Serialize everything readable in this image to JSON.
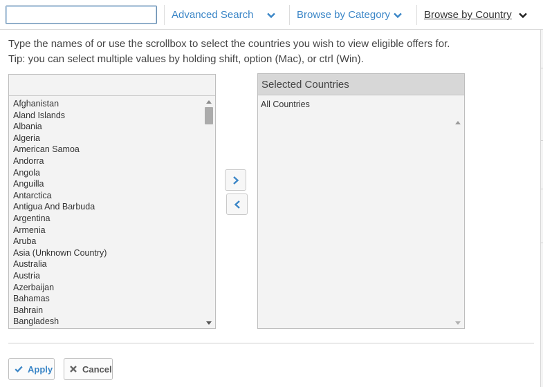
{
  "nav": {
    "search_value": "",
    "advanced_search": "Advanced Search",
    "browse_by_category": "Browse by Category",
    "browse_by_country": "Browse by Country",
    "active_color": "#333333",
    "link_color": "#3b86c7"
  },
  "instructions": {
    "line1": "Type the names of or use the scrollbox to select the countries you wish to view eligible offers for.",
    "line2": "Tip: you can select multiple values by holding shift, option (Mac), or ctrl (Win)."
  },
  "available": {
    "filter_value": "",
    "countries": [
      "Afghanistan",
      "Aland Islands",
      "Albania",
      "Algeria",
      "American Samoa",
      "Andorra",
      "Angola",
      "Anguilla",
      "Antarctica",
      "Antigua And Barbuda",
      "Argentina",
      "Armenia",
      "Aruba",
      "Asia (Unknown Country)",
      "Australia",
      "Austria",
      "Azerbaijan",
      "Bahamas",
      "Bahrain",
      "Bangladesh"
    ]
  },
  "selected": {
    "header": "Selected Countries",
    "items": [
      "All Countries"
    ]
  },
  "movers": {
    "add_icon": "chevron-right-icon",
    "remove_icon": "chevron-left-icon"
  },
  "footer": {
    "apply_label": "Apply",
    "cancel_label": "Cancel",
    "apply_icon": "check-icon",
    "cancel_icon": "times-icon"
  }
}
